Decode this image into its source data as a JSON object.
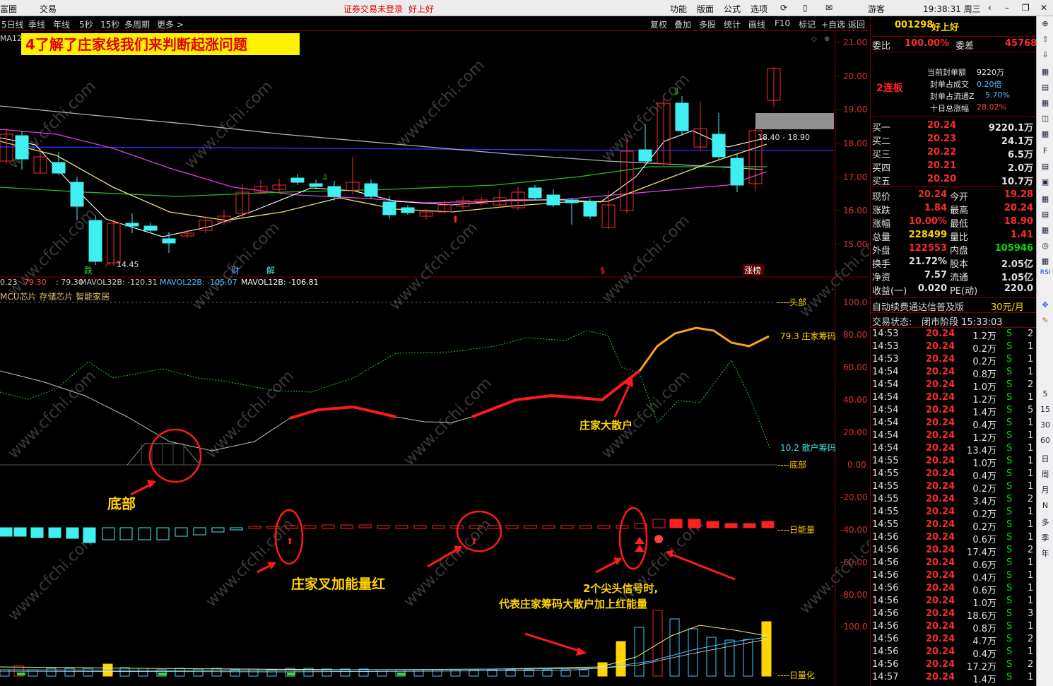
{
  "top": {
    "app": "富圈",
    "menu": "交易",
    "status_left": "证券交易未登录",
    "status_right": "好上好",
    "nav": [
      "功能",
      "版面",
      "公式",
      "选项"
    ],
    "user": "游客",
    "clock": "19:38:31 周三"
  },
  "tb": {
    "periods": [
      "5日线",
      "季线",
      "年线",
      "5秒",
      "15秒",
      "多周期",
      "更多 >"
    ],
    "tools": [
      "复权",
      "叠加",
      "多股",
      "统计",
      "画线",
      "F10",
      "标记",
      "+自选",
      "返回"
    ]
  },
  "main": {
    "ma_label": "MA12",
    "banner": "4了解了庄家线我们来判断起涨问题",
    "y_ticks": [
      "21.00",
      "20.00",
      "19.00",
      "18.00",
      "17.00",
      "16.00",
      "15.00"
    ],
    "low_label": "14.45",
    "range_label": "18.40 - 18.90",
    "markers": [
      "跌",
      "财",
      "解",
      "$",
      "涨榜"
    ]
  },
  "mid": {
    "stats": [
      [
        "0.23",
        "#d0d0d0"
      ],
      [
        "79.30",
        "#ff5050"
      ],
      [
        ": 79.30",
        "#d0d0d0"
      ],
      [
        "MAVOL32B: -120.31",
        "#d0d0d0"
      ],
      [
        "MAVOL22B: -105.07",
        "#40c8ff"
      ],
      [
        "MAVOL12B: -106.81",
        "#ffffff"
      ]
    ],
    "tags": "MCU芯片 存储芯片 智能家居",
    "y_ticks": [
      "100.0",
      "80.00",
      "60.00",
      "40.00",
      "20.00",
      "0.00",
      "-20.00",
      "-40.00",
      "-60.00",
      "-80.00",
      "-100.0"
    ],
    "lbl_top": "头部",
    "lbl_bottom": "底部",
    "lbl_zhuang": "79.3 庄家筹码",
    "lbl_sanhu": "10.2 散户筹码",
    "lbl_energy": "日能量",
    "lbl_vol": "日量化"
  },
  "ann": {
    "bottom": "底部",
    "zhuang_da": "庄家大散户",
    "cross": "庄家叉加能量红",
    "signal_1": "2个尖头信号时,",
    "signal_2": "代表庄家筹码大散户加上红能量"
  },
  "wm": "www.cfchi.com",
  "rp": {
    "code": "001298",
    "name": "好上好",
    "wb_l": "委比",
    "wb_v": "100.00%",
    "wc_l": "委差",
    "wc_v": "45768",
    "lb": "2连板",
    "seal": [
      [
        "当前封单额",
        "9220万"
      ],
      [
        "封单占成交",
        "0.20倍"
      ],
      [
        "封单占流通Z",
        "5.70%"
      ],
      [
        "十日总涨幅",
        "28.02%"
      ]
    ],
    "bids": [
      [
        "买一",
        "20.24",
        "9220.1万"
      ],
      [
        "买二",
        "20.23",
        "24.1万"
      ],
      [
        "买三",
        "20.22",
        "6.5万"
      ],
      [
        "买四",
        "20.21",
        "2.0万"
      ],
      [
        "买五",
        "20.20",
        "10.7万"
      ]
    ],
    "q": [
      [
        "现价",
        "20.24",
        "今开",
        "19.28"
      ],
      [
        "涨跌",
        "1.84",
        "最高",
        "20.24"
      ],
      [
        "涨幅",
        "10.00%",
        "最低",
        "18.90"
      ],
      [
        "总量",
        "228499",
        "量比",
        "1.41"
      ],
      [
        "外盘",
        "122553",
        "内盘",
        "105946"
      ],
      [
        "换手",
        "21.72%",
        "股本",
        "2.05亿"
      ],
      [
        "净资",
        "7.57",
        "流通",
        "1.05亿"
      ],
      [
        "收益(一)",
        "0.020",
        "PE(动)",
        "220.0"
      ]
    ],
    "promo": "自动续费通达信普及版",
    "price": "30元/月",
    "state_l": "交易状态:",
    "state_v": "闭市阶段 15:33:03",
    "ticks": [
      [
        "14:53",
        "1.2万",
        "2"
      ],
      [
        "14:53",
        "0.2万",
        "1"
      ],
      [
        "14:53",
        "0.2万",
        "1"
      ],
      [
        "14:54",
        "0.8万",
        "1"
      ],
      [
        "14:54",
        "1.0万",
        "2"
      ],
      [
        "14:54",
        "1.2万",
        "1"
      ],
      [
        "14:54",
        "1.4万",
        "5"
      ],
      [
        "14:54",
        "0.4万",
        "1"
      ],
      [
        "14:54",
        "1.2万",
        "1"
      ],
      [
        "14:54",
        "13.4万",
        "1"
      ],
      [
        "14:55",
        "1.0万",
        "1"
      ],
      [
        "14:55",
        "0.4万",
        "1"
      ],
      [
        "14:55",
        "0.2万",
        "1"
      ],
      [
        "14:55",
        "3.4万",
        "2"
      ],
      [
        "14:55",
        "0.2万",
        "1"
      ],
      [
        "14:55",
        "0.2万",
        "1"
      ],
      [
        "14:56",
        "0.6万",
        "1"
      ],
      [
        "14:56",
        "17.4万",
        "2"
      ],
      [
        "14:56",
        "0.6万",
        "1"
      ],
      [
        "14:56",
        "0.4万",
        "1"
      ],
      [
        "14:56",
        "0.6万",
        "1"
      ],
      [
        "14:56",
        "1.0万",
        "1"
      ],
      [
        "14:56",
        "18.6万",
        "3"
      ],
      [
        "14:56",
        "0.8万",
        "1"
      ],
      [
        "14:56",
        "4.7万",
        "2"
      ],
      [
        "14:56",
        "0.4万",
        "1"
      ],
      [
        "14:56",
        "17.2万",
        "2"
      ],
      [
        "14:57",
        "1.4万",
        "1"
      ]
    ],
    "tick_price": "20.24",
    "tick_dir": "S"
  },
  "side": [
    "5",
    "15",
    "30",
    "60",
    "日",
    "周",
    "月",
    "N",
    "多",
    "季",
    "年",
    "RSI"
  ]
}
